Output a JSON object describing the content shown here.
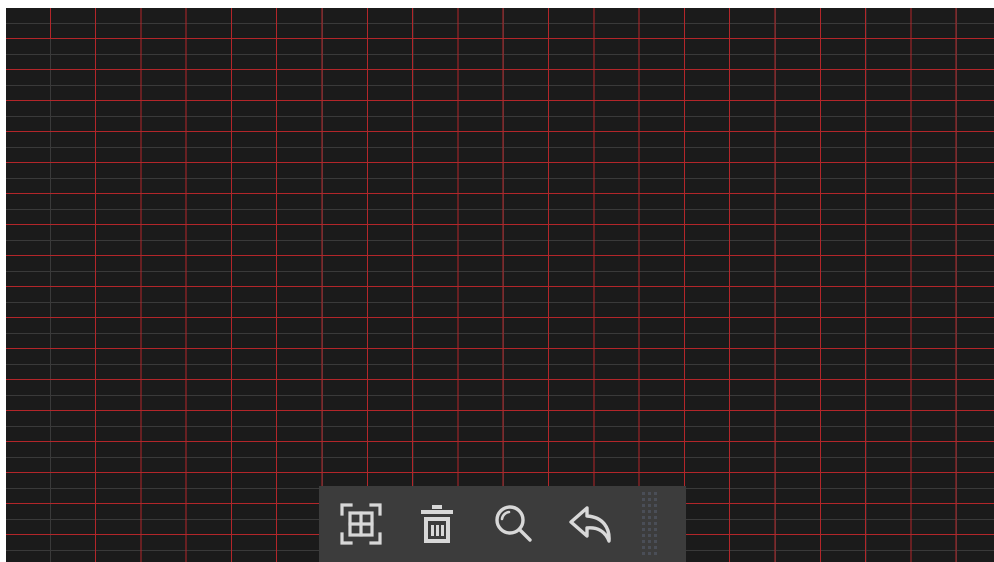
{
  "viewport": {
    "background": "#1b1b1b",
    "grid": {
      "major_color": "#b3262a",
      "minor_color": "#3a3a3a"
    }
  },
  "toolbar": {
    "background": "#3c3c3c",
    "icon_color": "#d8d8d8",
    "tools": [
      {
        "name": "fit-screen-icon"
      },
      {
        "name": "trash-icon"
      },
      {
        "name": "zoom-icon"
      },
      {
        "name": "undo-icon"
      }
    ],
    "grip_icon": "drag-handle-icon"
  }
}
